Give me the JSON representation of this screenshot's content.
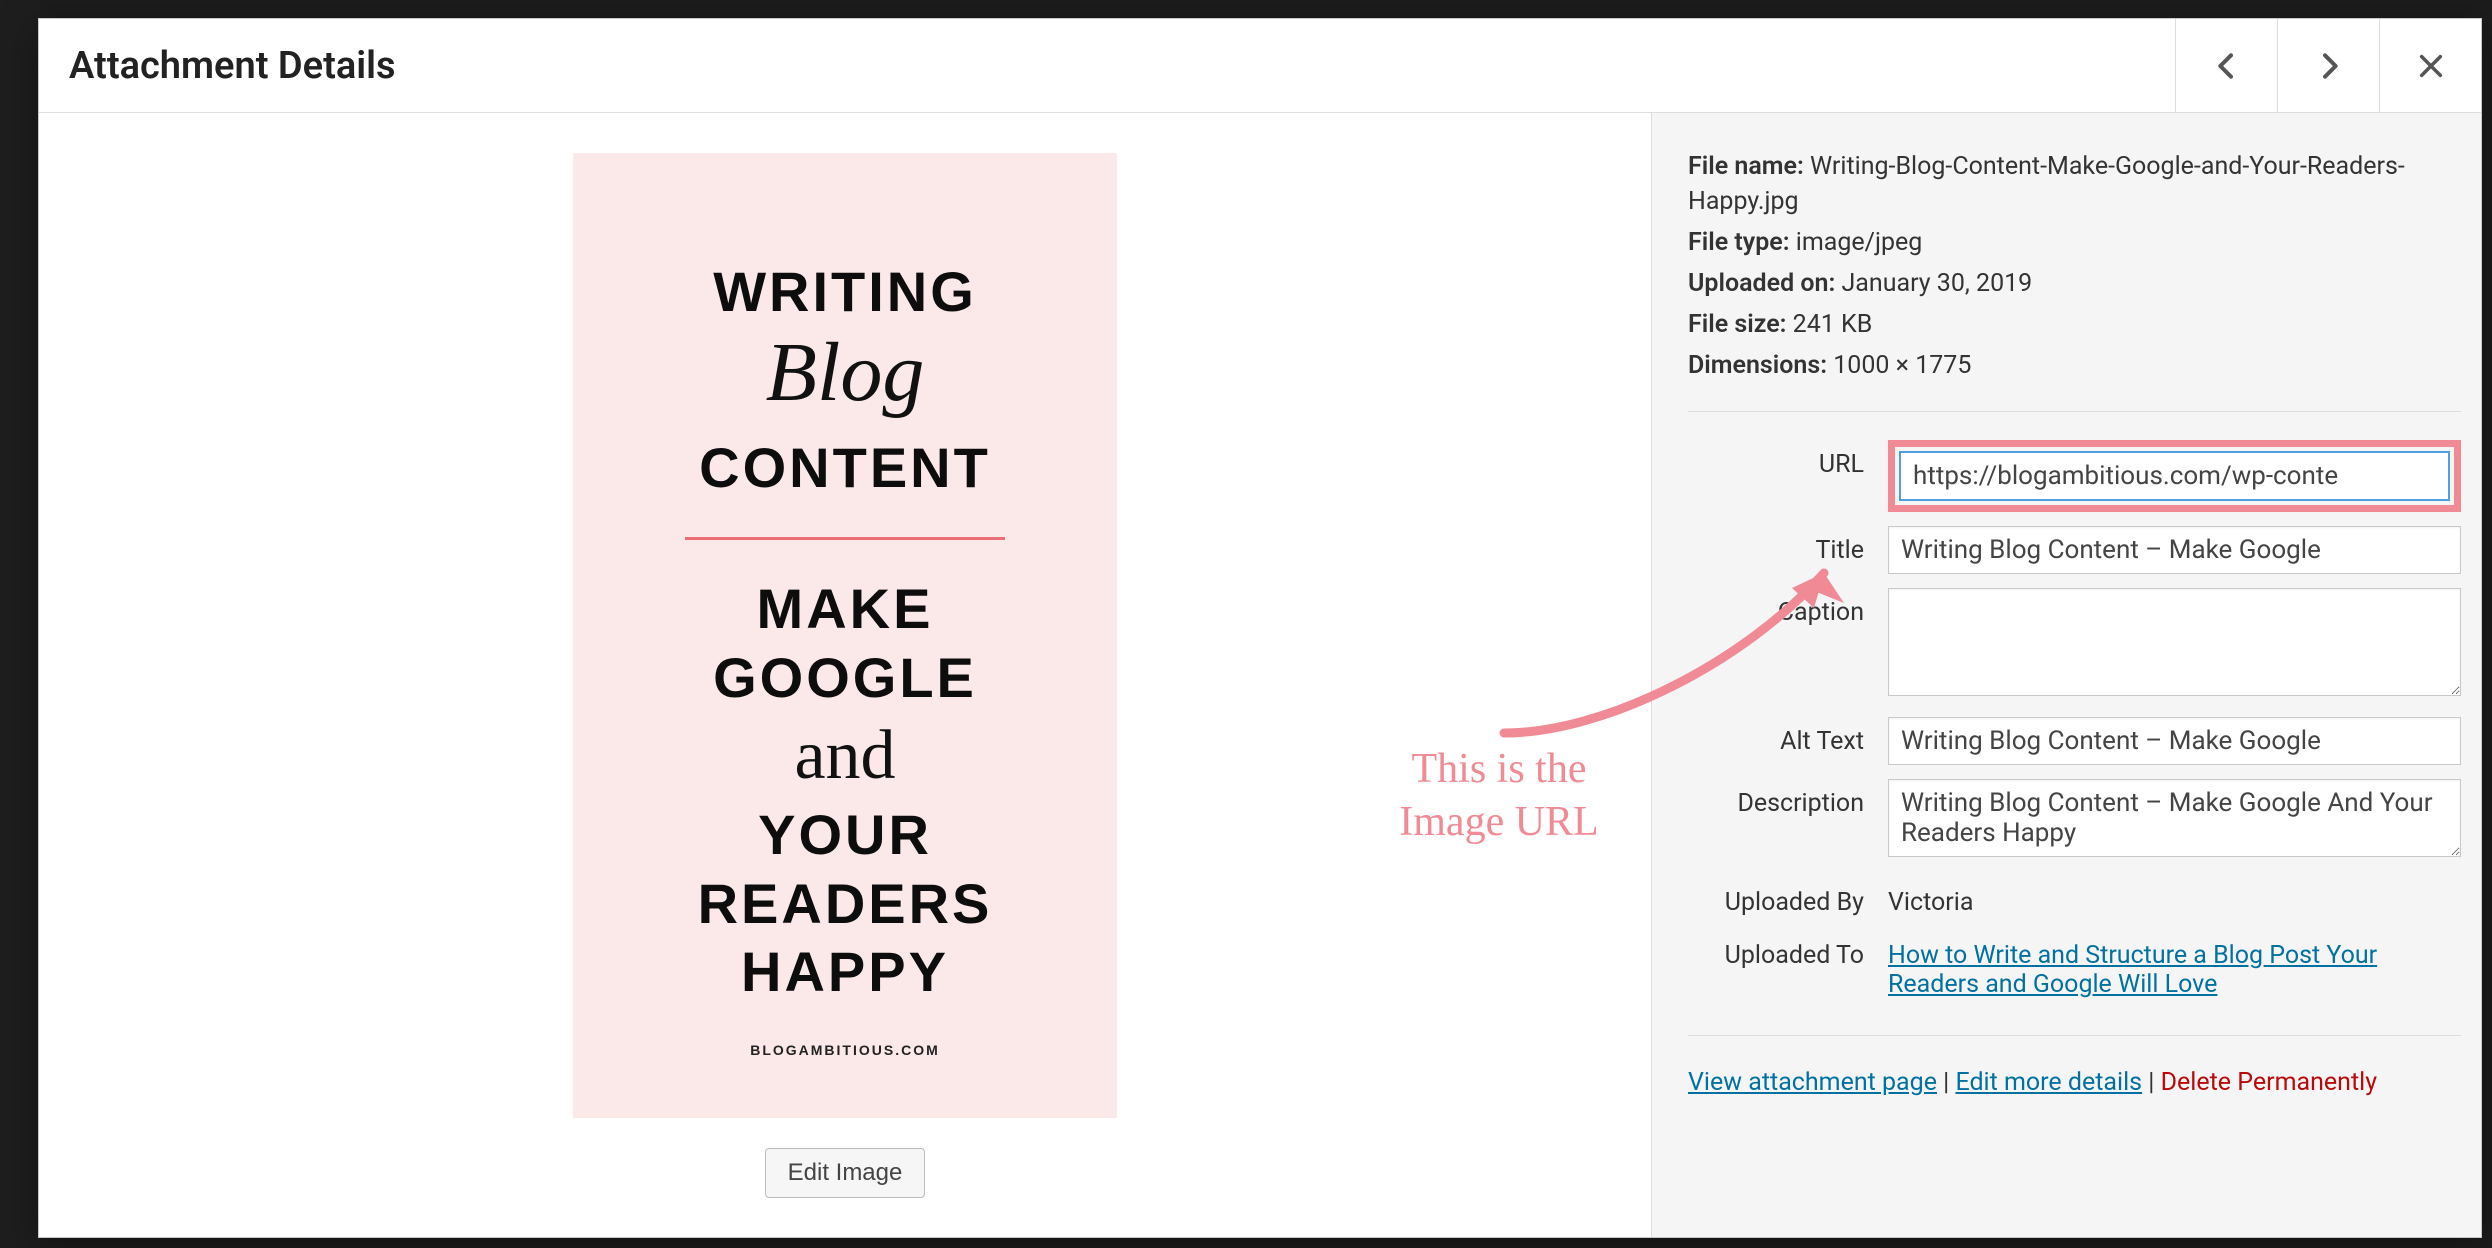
{
  "modal": {
    "title": "Attachment Details",
    "prev_aria": "Previous",
    "next_aria": "Next",
    "close_aria": "Close"
  },
  "preview": {
    "image_words": {
      "w1": "WRITING",
      "w2": "Blog",
      "w3": "CONTENT",
      "w4": "MAKE",
      "w5": "GOOGLE",
      "w6": "and",
      "w7": "YOUR",
      "w8": "READERS",
      "w9": "HAPPY",
      "brand": "BLOGAMBITIOUS.COM"
    },
    "edit_image_label": "Edit Image"
  },
  "annotation": {
    "line1": "This is the",
    "line2": "Image URL"
  },
  "meta": {
    "file_name_label": "File name:",
    "file_name_value": "Writing-Blog-Content-Make-Google-and-Your-Readers-Happy.jpg",
    "file_type_label": "File type:",
    "file_type_value": "image/jpeg",
    "uploaded_on_label": "Uploaded on:",
    "uploaded_on_value": "January 30, 2019",
    "file_size_label": "File size:",
    "file_size_value": "241 KB",
    "dimensions_label": "Dimensions:",
    "dimensions_value": "1000 × 1775"
  },
  "fields": {
    "url_label": "URL",
    "url_value": "https://blogambitious.com/wp-conte",
    "title_label": "Title",
    "title_value": "Writing Blog Content – Make Google",
    "caption_label": "Caption",
    "caption_value": "",
    "alt_label": "Alt Text",
    "alt_value": "Writing Blog Content – Make Google",
    "description_label": "Description",
    "description_value": "Writing Blog Content – Make Google And Your Readers Happy",
    "uploaded_by_label": "Uploaded By",
    "uploaded_by_value": "Victoria",
    "uploaded_to_label": "Uploaded To",
    "uploaded_to_link": "How to Write and Structure a Blog Post Your Readers and Google Will Love"
  },
  "bottom_links": {
    "view": "View attachment page",
    "edit": "Edit more details",
    "delete": "Delete Permanently",
    "sep": " | "
  }
}
